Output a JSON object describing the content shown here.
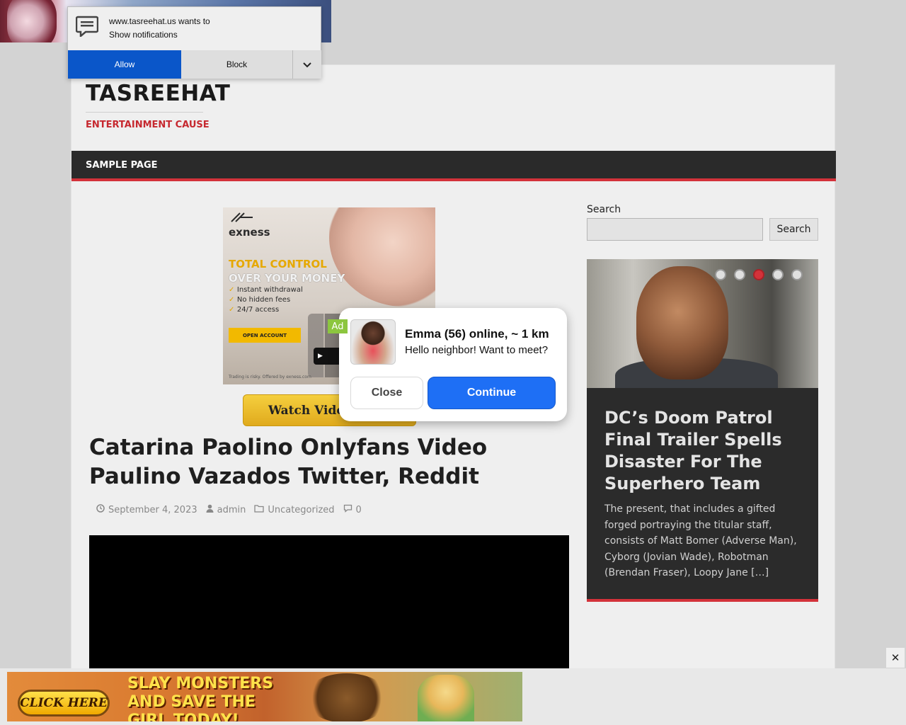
{
  "notification": {
    "origin_line": "www.tasreehat.us wants to",
    "request_line": "Show notifications",
    "allow_label": "Allow",
    "block_label": "Block"
  },
  "site": {
    "title": "TASREEHAT",
    "tagline": "ENTERTAINMENT CAUSE",
    "nav": [
      "SAMPLE PAGE"
    ]
  },
  "exness_ad": {
    "logo": "exness",
    "headline_1": "TOTAL CONTROL",
    "headline_2": "OVER YOUR MONEY",
    "bullets": [
      "Instant withdrawal",
      "No hidden fees",
      "24/7 access"
    ],
    "cta": "OPEN ACCOUNT",
    "store": "GET IT ON Google Play",
    "disclaimer": "Trading is risky. Offered by exness.com"
  },
  "watch_button": "Watch Video",
  "post": {
    "title": "Catarina Paolino Onlyfans Video Paulino Vazados Twitter, Reddit",
    "date": "September 4, 2023",
    "author": "admin",
    "category": "Uncategorized",
    "comments": "0"
  },
  "sidebar": {
    "search_label": "Search",
    "search_value": "",
    "search_button": "Search",
    "slider": {
      "active_index": 3,
      "dot_count": 5,
      "title": "DC’s Doom Patrol Final Trailer Spells Disaster For The Superhero Team",
      "excerpt": "The present, that includes a gifted forged portraying the titular staff, consists of Matt Bomer (Adverse Man), Cyborg (Jovian Wade), Robotman (Brendan Fraser), Loopy Jane […]"
    }
  },
  "popup": {
    "ad_badge": "Ad",
    "name": "Emma (56) online, ~ 1 km",
    "message": "Hello neighbor! Want to meet?",
    "close_label": "Close",
    "continue_label": "Continue"
  },
  "bottom_ad": {
    "cta": "CLICK HERE",
    "text_1": "SLAY MONSTERS",
    "text_2": "AND SAVE THE",
    "text_3": "GIRL TODAY!"
  },
  "colors": {
    "accent_red": "#d3323a",
    "nav_bg": "#2a2a2a",
    "allow_blue": "#0a56c9",
    "continue_blue": "#1e6ff5"
  }
}
